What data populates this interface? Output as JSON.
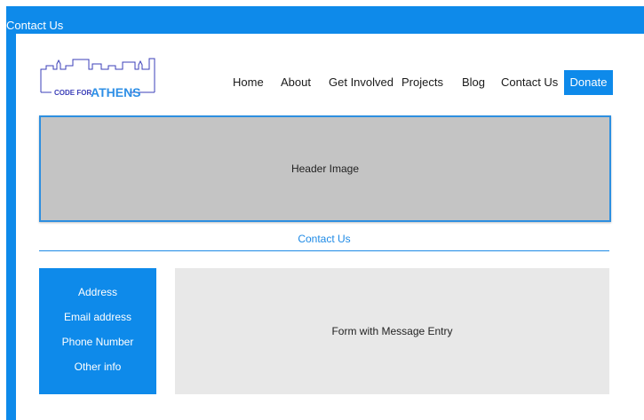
{
  "window": {
    "title": "Contact Us"
  },
  "logo": {
    "text_prefix": "CODE FOR",
    "text_main": "ATHENS"
  },
  "nav": {
    "items": [
      {
        "label": "Home"
      },
      {
        "label": "About"
      },
      {
        "label": "Get Involved"
      },
      {
        "label": "Projects"
      },
      {
        "label": "Blog"
      },
      {
        "label": "Contact Us"
      }
    ],
    "donate_label": "Donate"
  },
  "header_image": {
    "label": "Header Image"
  },
  "section": {
    "title": "Contact Us"
  },
  "info": {
    "items": [
      "Address",
      "Email address",
      "Phone Number",
      "Other info"
    ]
  },
  "form": {
    "label": "Form with Message Entry"
  },
  "colors": {
    "accent": "#0e8aea",
    "logo_stroke": "#3b3fb8",
    "placeholder_gray": "#c4c4c4"
  }
}
